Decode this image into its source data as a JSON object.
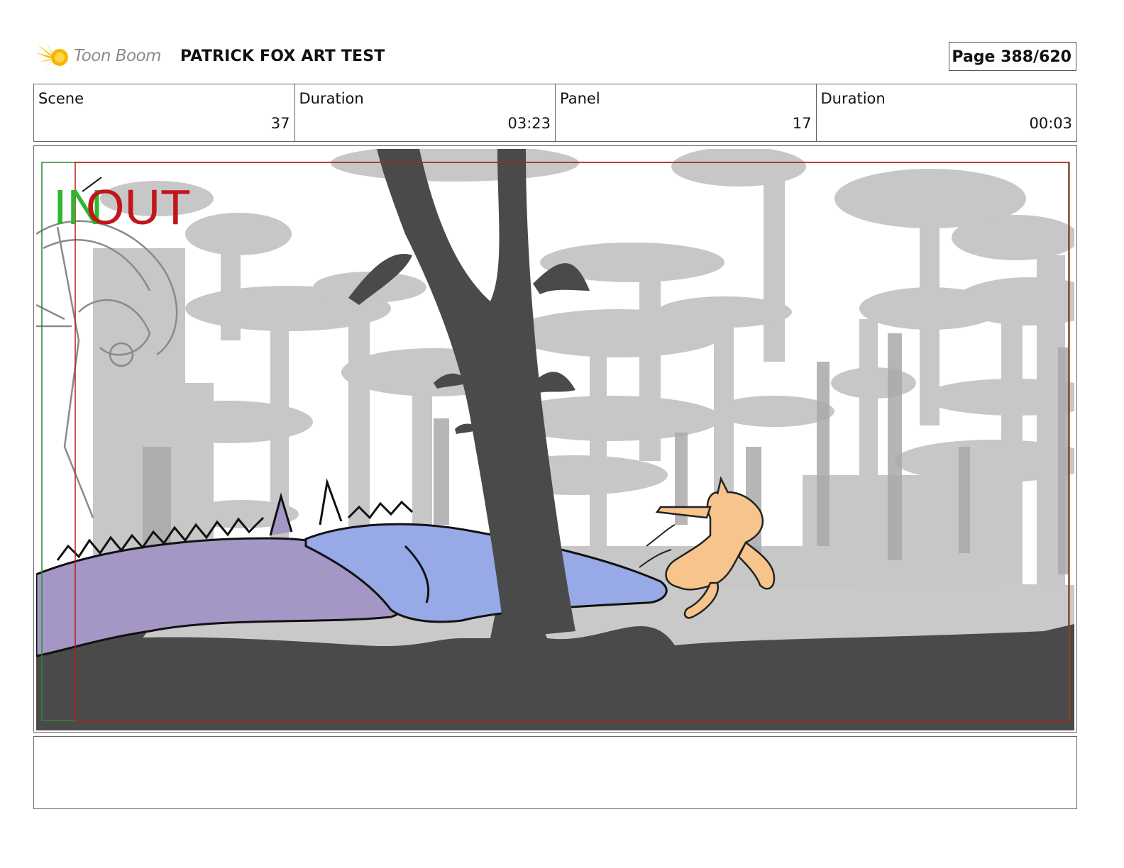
{
  "header": {
    "logo_text": "Toon Boom",
    "project_title": "PATRICK FOX ART TEST",
    "page_indicator": "Page 388/620"
  },
  "info_table": {
    "scene_label": "Scene",
    "scene_value": "37",
    "scene_duration_label": "Duration",
    "scene_duration_value": "03:23",
    "panel_label": "Panel",
    "panel_value": "17",
    "panel_duration_label": "Duration",
    "panel_duration_value": "00:03"
  },
  "panel_overlay": {
    "in_label": "IN",
    "out_label": "OUT",
    "in_color": "#2db82d",
    "out_color": "#c0161b"
  },
  "notes": {
    "text": ""
  },
  "colors": {
    "logo_accent": "#f5c400",
    "border": "#666666"
  }
}
